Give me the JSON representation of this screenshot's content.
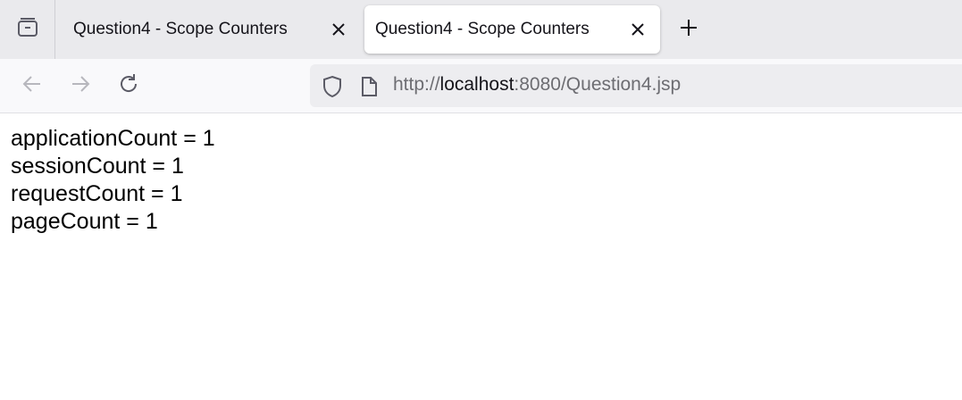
{
  "tabs": [
    {
      "title": "Question4 - Scope Counters",
      "active": false
    },
    {
      "title": "Question4 - Scope Counters",
      "active": true
    }
  ],
  "icons": {
    "tab_list": "tab-list-icon",
    "close": "close-icon",
    "new_tab": "plus-icon",
    "back": "back-arrow-icon",
    "forward": "forward-arrow-icon",
    "reload": "reload-icon",
    "shield": "shield-icon",
    "page": "page-icon"
  },
  "address": {
    "scheme": "http://",
    "host": "localhost",
    "rest": ":8080/Question4.jsp"
  },
  "content": {
    "lines": [
      "applicationCount = 1",
      "sessionCount = 1",
      "requestCount = 1",
      "pageCount = 1"
    ]
  },
  "colors": {
    "tabbar_bg": "#eaeaed",
    "toolbar_bg": "#f9f9fb",
    "urlbar_bg": "#ededf0",
    "icon": "#5b5b66"
  }
}
